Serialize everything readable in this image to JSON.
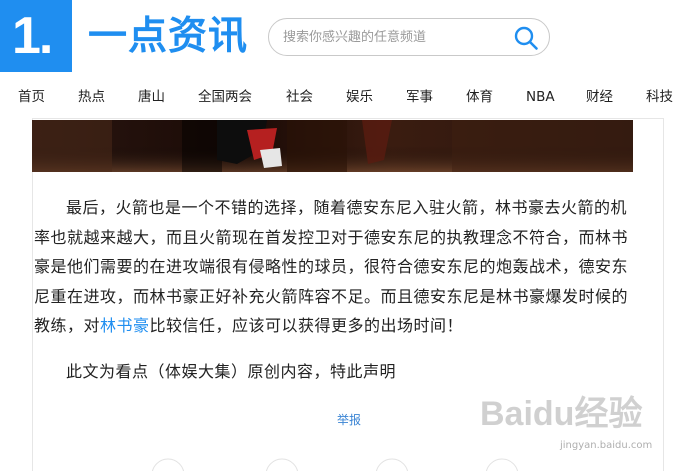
{
  "header": {
    "logo_number": "1.",
    "logo_text": "一点资讯",
    "search": {
      "placeholder": "搜索你感兴趣的任意频道"
    }
  },
  "nav": {
    "items": [
      "首页",
      "热点",
      "唐山",
      "全国两会",
      "社会",
      "娱乐",
      "军事",
      "体育",
      "NBA",
      "财经",
      "科技"
    ]
  },
  "article": {
    "paragraph1_before_link": "最后，火箭也是一个不错的选择，随着德安东尼入驻火箭，林书豪去火箭的机率也就越来越大，而且火箭现在首发控卫对于德安东尼的执教理念不符合，而林书豪是他们需要的在进攻端很有侵略性的球员，很符合德安东尼的炮轰战术，德安东尼重在进攻，而林书豪正好补充火箭阵容不足。而且德安东尼是林书豪爆发时候的教练，对",
    "link_text": "林书豪",
    "paragraph1_after_link": "比较信任，应该可以获得更多的出场时间！",
    "paragraph2": "此文为看点（体娱大集）原创内容，特此声明",
    "report_label": "举报"
  },
  "watermark": {
    "text": "Baidu经验",
    "url_text": "jingyan.baidu.com"
  },
  "colors": {
    "brand_blue": "#1f8ef0",
    "link_blue": "#1f8ef0"
  },
  "icons": {
    "search": "search-icon"
  }
}
